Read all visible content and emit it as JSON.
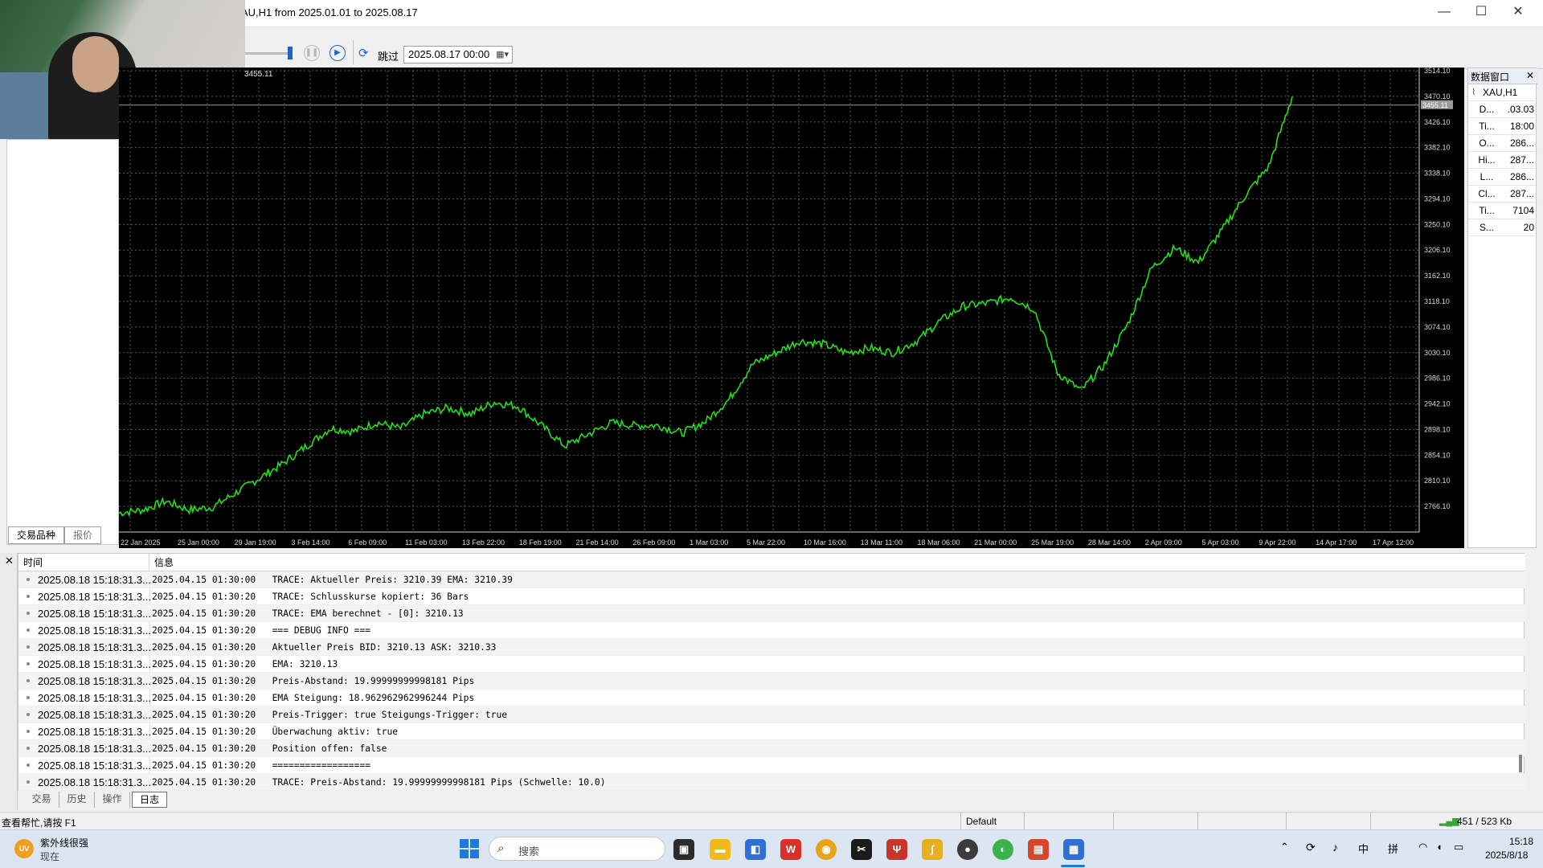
{
  "window": {
    "title": "AU,H1 from 2025.01.01 to 2025.08.17",
    "min_glyph": "—",
    "max_glyph": "☐",
    "close_glyph": "✕"
  },
  "toolbar": {
    "skip_label": "跳过",
    "date_value": "2025.08.17 00:00"
  },
  "left_panel": {
    "tabs": [
      "交易品种",
      "报价"
    ]
  },
  "chart_data": {
    "type": "line",
    "symbol_label": "3455.11",
    "price_label": "3455.11",
    "color": "#22e01a",
    "ylim": [
      2722.1,
      3514.1
    ],
    "y_ticks": [
      "3514.10",
      "3470.10",
      "3426.10",
      "3382.10",
      "3338.10",
      "3294.10",
      "3250.10",
      "3206.10",
      "3162.10",
      "3118.10",
      "3074.10",
      "3030.10",
      "2986.10",
      "2942.10",
      "2898.10",
      "2854.10",
      "2810.10",
      "2766.10"
    ],
    "x_ticks": [
      "22 Jan 2025",
      "25 Jan 00:00",
      "29 Jan 19:00",
      "3 Feb 14:00",
      "6 Feb 09:00",
      "11 Feb 03:00",
      "13 Feb 22:00",
      "18 Feb 19:00",
      "21 Feb 14:00",
      "26 Feb 09:00",
      "1 Mar 03:00",
      "5 Mar 22:00",
      "10 Mar 16:00",
      "13 Mar 11:00",
      "18 Mar 06:00",
      "21 Mar 00:00",
      "25 Mar 19:00",
      "28 Mar 14:00",
      "2 Apr 09:00",
      "5 Apr 03:00",
      "9 Apr 22:00",
      "14 Apr 17:00",
      "17 Apr 12:00"
    ],
    "x": [
      0,
      2,
      4,
      6,
      8,
      10,
      12,
      14,
      16,
      18,
      20,
      22,
      24,
      26,
      28,
      30,
      32,
      34,
      36,
      38,
      40,
      42,
      44,
      46,
      48,
      50,
      52,
      54,
      56,
      58,
      60,
      62,
      64,
      66,
      68,
      70,
      72,
      74,
      76,
      78,
      80,
      82,
      84,
      86,
      88,
      90,
      92,
      94,
      96,
      98,
      100
    ],
    "values": [
      2755,
      2760,
      2775,
      2760,
      2765,
      2790,
      2815,
      2840,
      2870,
      2900,
      2895,
      2910,
      2900,
      2925,
      2935,
      2925,
      2945,
      2938,
      2905,
      2870,
      2890,
      2910,
      2905,
      2905,
      2892,
      2912,
      2950,
      3010,
      3030,
      3050,
      3045,
      3030,
      3038,
      3030,
      3050,
      3085,
      3110,
      3115,
      3125,
      3105,
      2995,
      2965,
      3010,
      3080,
      3175,
      3210,
      3185,
      3240,
      3300,
      3350,
      3470
    ]
  },
  "data_window": {
    "title": "数据窗口",
    "close_glyph": "✕",
    "symbol": "XAU,H1",
    "rows": [
      {
        "k": "D...",
        "v": ".03.03"
      },
      {
        "k": "Ti...",
        "v": "18:00"
      },
      {
        "k": "O...",
        "v": "286..."
      },
      {
        "k": "Hi...",
        "v": "287..."
      },
      {
        "k": "L...",
        "v": "286..."
      },
      {
        "k": "Cl...",
        "v": "287..."
      },
      {
        "k": "Ti...",
        "v": "7104"
      },
      {
        "k": "S...",
        "v": "20"
      }
    ]
  },
  "log": {
    "col_time": "时间",
    "col_info": "信息",
    "rows": [
      {
        "time": "2025.08.18 15:18:31.3...",
        "msg": "2025.04.15 01:30:00   TRACE: Aktueller Preis: 3210.39 EMA: 3210.39"
      },
      {
        "time": "2025.08.18 15:18:31.3...",
        "msg": "2025.04.15 01:30:20   TRACE: Schlusskurse kopiert: 36 Bars"
      },
      {
        "time": "2025.08.18 15:18:31.3...",
        "msg": "2025.04.15 01:30:20   TRACE: EMA berechnet - [0]: 3210.13"
      },
      {
        "time": "2025.08.18 15:18:31.3...",
        "msg": "2025.04.15 01:30:20   === DEBUG INFO ==="
      },
      {
        "time": "2025.08.18 15:18:31.3...",
        "msg": "2025.04.15 01:30:20   Aktueller Preis BID: 3210.13 ASK: 3210.33"
      },
      {
        "time": "2025.08.18 15:18:31.3...",
        "msg": "2025.04.15 01:30:20   EMA: 3210.13"
      },
      {
        "time": "2025.08.18 15:18:31.3...",
        "msg": "2025.04.15 01:30:20   Preis-Abstand: 19.99999999998181 Pips"
      },
      {
        "time": "2025.08.18 15:18:31.3...",
        "msg": "2025.04.15 01:30:20   EMA Steigung: 18.962962962996244 Pips"
      },
      {
        "time": "2025.08.18 15:18:31.3...",
        "msg": "2025.04.15 01:30:20   Preis-Trigger: true Steigungs-Trigger: true"
      },
      {
        "time": "2025.08.18 15:18:31.3...",
        "msg": "2025.04.15 01:30:20   Überwachung aktiv: true"
      },
      {
        "time": "2025.08.18 15:18:31.3...",
        "msg": "2025.04.15 01:30:20   Position offen: false"
      },
      {
        "time": "2025.08.18 15:18:31.3...",
        "msg": "2025.04.15 01:30:20   =================="
      },
      {
        "time": "2025.08.18 15:18:31.3...",
        "msg": "2025.04.15 01:30:20   TRACE: Preis-Abstand: 19.99999999998181 Pips (Schwelle: 10.0)"
      }
    ],
    "tabs": [
      "交易",
      "历史",
      "操作",
      "日志"
    ]
  },
  "statusbar": {
    "help": "查看帮忙,请按 F1",
    "profile": "Default",
    "traffic": "451 / 523 Kb"
  },
  "taskbar": {
    "weather_title": "紫外线很强",
    "weather_sub": "现在",
    "weather_badge": "UV",
    "search_placeholder": "搜索",
    "ime_lang": "中",
    "ime_mode": "拼",
    "time": "15:18",
    "date": "2025/8/18"
  }
}
